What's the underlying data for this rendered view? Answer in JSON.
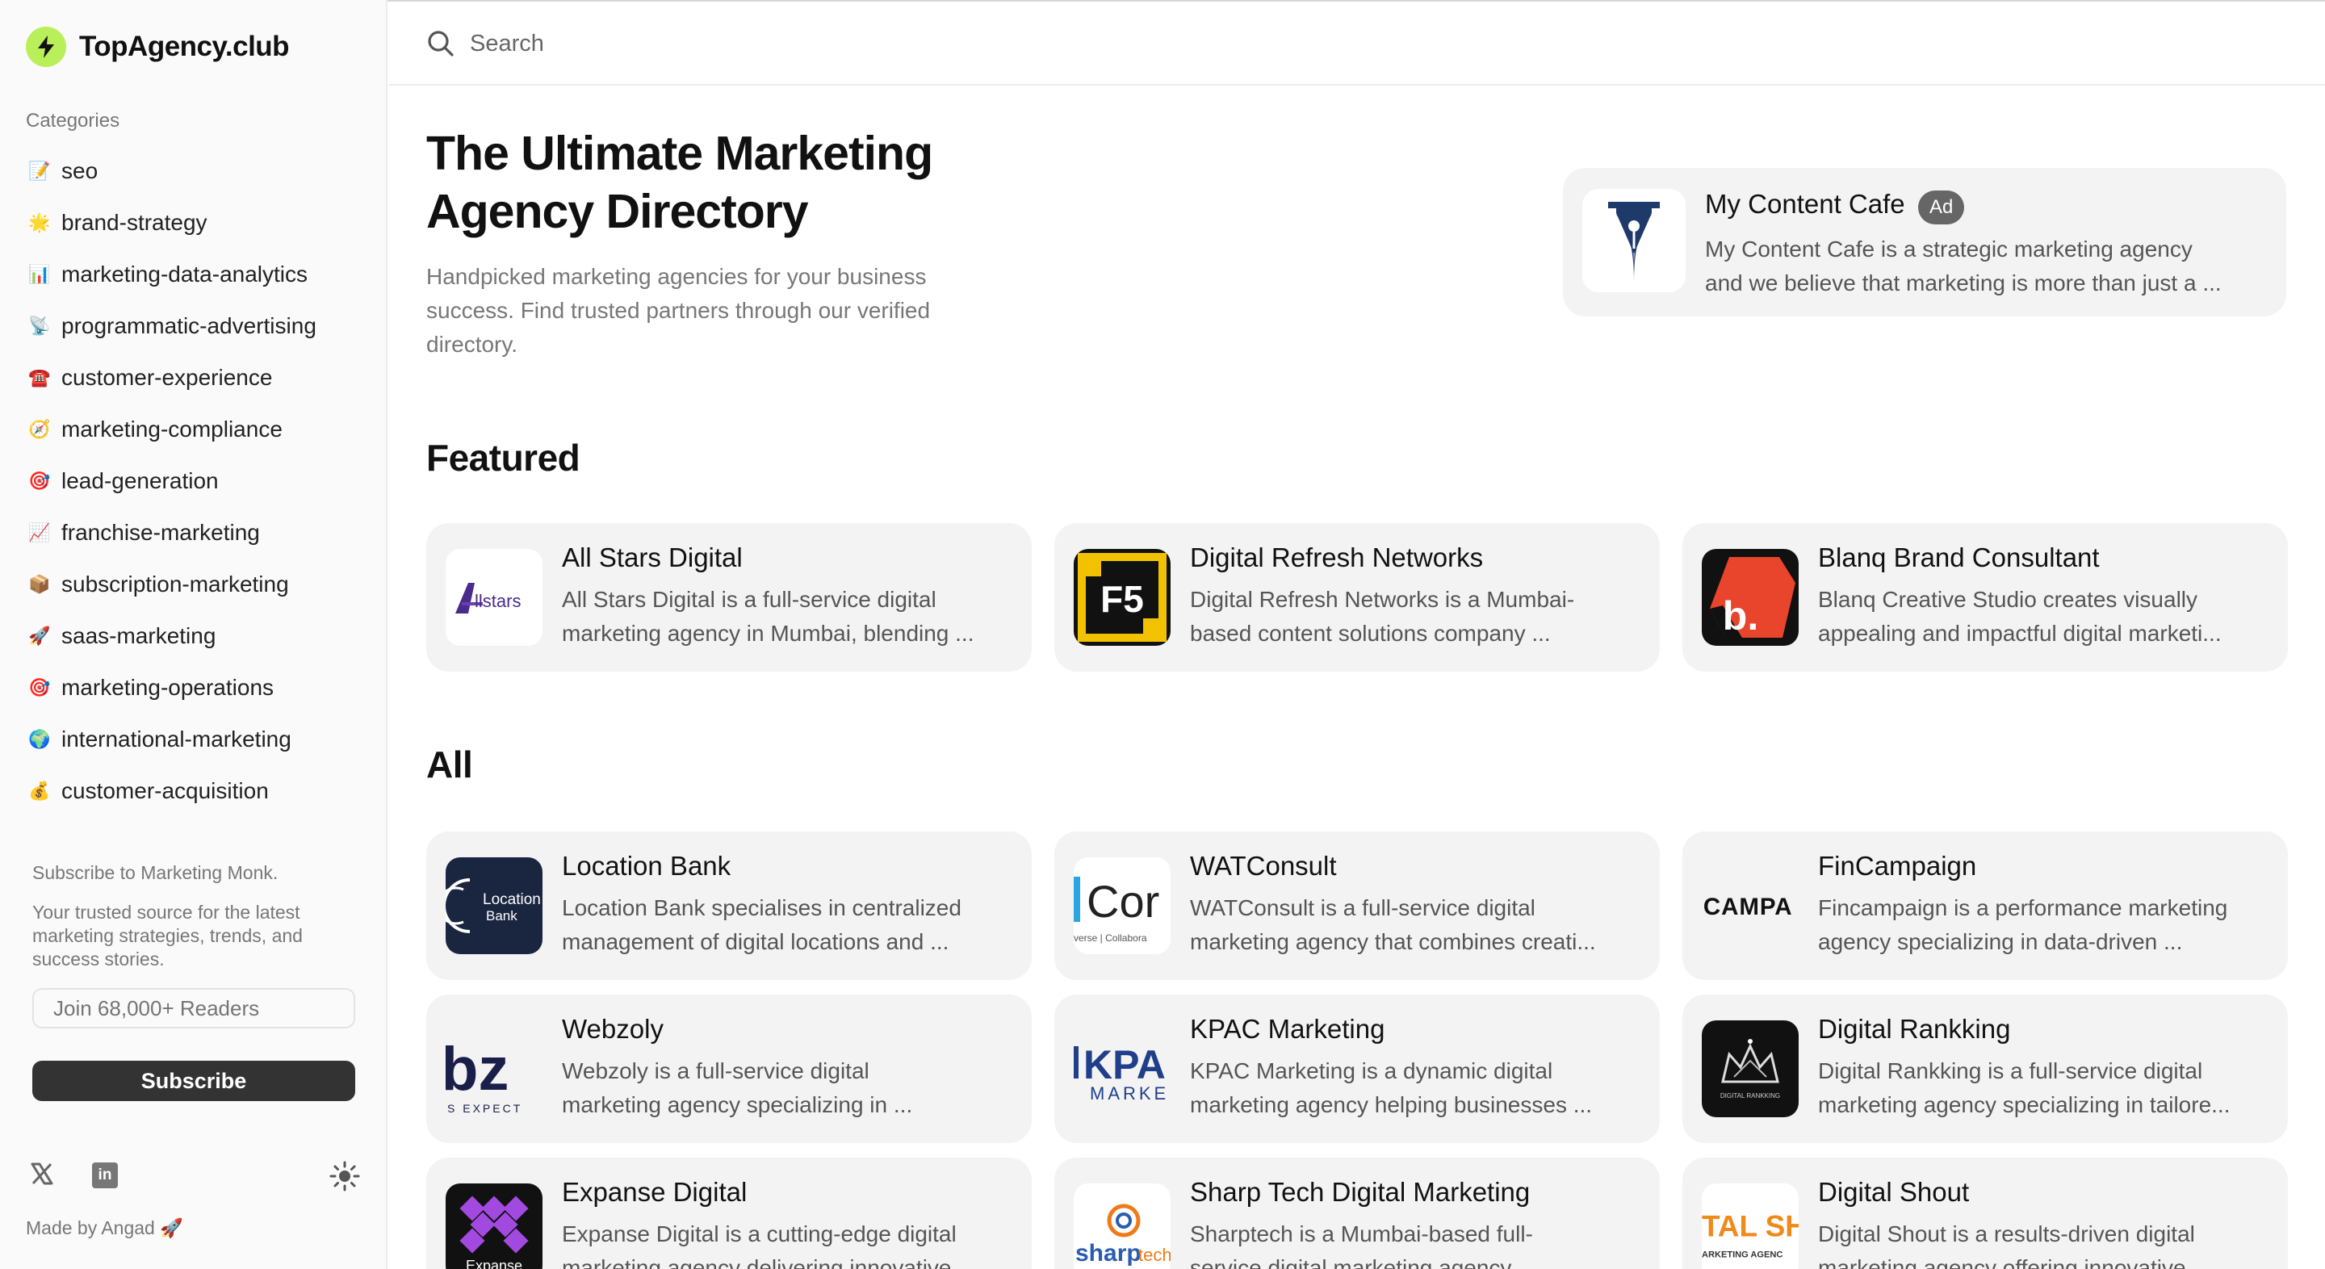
{
  "brand": {
    "name": "TopAgency.club",
    "logo_icon": "lightning-bolt-icon",
    "logo_color": "#b9f05a"
  },
  "sidebar": {
    "categories_heading": "Categories",
    "categories": [
      {
        "emoji": "📝",
        "label": "seo"
      },
      {
        "emoji": "🌟",
        "label": "brand-strategy"
      },
      {
        "emoji": "📊",
        "label": "marketing-data-analytics"
      },
      {
        "emoji": "📡",
        "label": "programmatic-advertising"
      },
      {
        "emoji": "☎️",
        "label": "customer-experience"
      },
      {
        "emoji": "🧭",
        "label": "marketing-compliance"
      },
      {
        "emoji": "🎯",
        "label": "lead-generation"
      },
      {
        "emoji": "📈",
        "label": "franchise-marketing"
      },
      {
        "emoji": "📦",
        "label": "subscription-marketing"
      },
      {
        "emoji": "🚀",
        "label": "saas-marketing"
      },
      {
        "emoji": "🎯",
        "label": "marketing-operations"
      },
      {
        "emoji": "🌍",
        "label": "international-marketing"
      },
      {
        "emoji": "💰",
        "label": "customer-acquisition"
      }
    ],
    "subscribe": {
      "title": "Subscribe to Marketing Monk.",
      "description": "Your trusted source for the latest marketing strategies, trends, and success stories.",
      "input_placeholder": "Join 68,000+ Readers",
      "button_label": "Subscribe"
    },
    "social": {
      "x_label": "X",
      "linkedin_label": "in"
    },
    "made_by": "Made by Angad 🚀"
  },
  "search": {
    "placeholder": "Search"
  },
  "hero": {
    "title_line1": "The Ultimate Marketing",
    "title_line2": "Agency Directory",
    "subtitle_line1": "Handpicked marketing agencies for your business",
    "subtitle_line2": "success. Find trusted partners through our verified",
    "subtitle_line3": "directory."
  },
  "ad": {
    "name": "My Content Cafe",
    "badge": "Ad",
    "desc_line1": "My Content Cafe is a strategic marketing agency",
    "desc_line2": "and we believe that marketing is more than just a ..."
  },
  "featured": {
    "heading": "Featured",
    "cards": [
      {
        "name": "All Stars Digital",
        "line1": "All Stars Digital is a full-service digital",
        "line2": "marketing agency in Mumbai, blending ...",
        "logo_text": "llstars"
      },
      {
        "name": "Digital Refresh Networks",
        "line1": "Digital Refresh Networks is a Mumbai-",
        "line2": "based content solutions company ...",
        "logo_text": "F5"
      },
      {
        "name": "Blanq Brand Consultant",
        "line1": "Blanq Creative Studio creates visually",
        "line2": "appealing and impactful digital marketi...",
        "logo_text": "b."
      }
    ]
  },
  "all": {
    "heading": "All",
    "cards": [
      {
        "name": "Location Bank",
        "line1": "Location Bank specialises in centralized",
        "line2": "management of digital locations and ...",
        "logo_text": "Location",
        "logo_text2": "Bank"
      },
      {
        "name": "WATConsult",
        "line1": "WATConsult is a full-service digital",
        "line2": "marketing agency that combines creati...",
        "logo_text": "Cor",
        "logo_text2": "verse | Collabora"
      },
      {
        "name": "FinCampaign",
        "line1": "Fincampaign is a performance marketing",
        "line2": "agency specializing in data-driven ...",
        "logo_text": "CAMPA"
      },
      {
        "name": "Webzoly",
        "line1": "Webzoly is a full-service digital",
        "line2": "marketing agency specializing in ...",
        "logo_text": "bz",
        "logo_text2": "S EXPECT"
      },
      {
        "name": "KPAC Marketing",
        "line1": "KPAC Marketing is a dynamic digital",
        "line2": "marketing agency helping businesses ...",
        "logo_text": "KPA",
        "logo_text2": "MARKE"
      },
      {
        "name": "Digital Rankking",
        "line1": "Digital Rankking is a full-service digital",
        "line2": "marketing agency specializing in tailore...",
        "logo_text": "DIGITAL RANKKING"
      },
      {
        "name": "Expanse Digital",
        "line1": "Expanse Digital is a cutting-edge digital",
        "line2": "marketing agency delivering innovative ...",
        "logo_text": "Expanse"
      },
      {
        "name": "Sharp Tech Digital Marketing",
        "line1": "Sharptech is a Mumbai-based full-",
        "line2": "service digital marketing agency ...",
        "logo_text": "sharp",
        "logo_text2": "tech"
      },
      {
        "name": "Digital Shout",
        "line1": "Digital Shout is a results-driven digital",
        "line2": "marketing agency offering innovative ...",
        "logo_text": "TAL SH",
        "logo_text2": "ARKETING AGENC"
      }
    ]
  }
}
